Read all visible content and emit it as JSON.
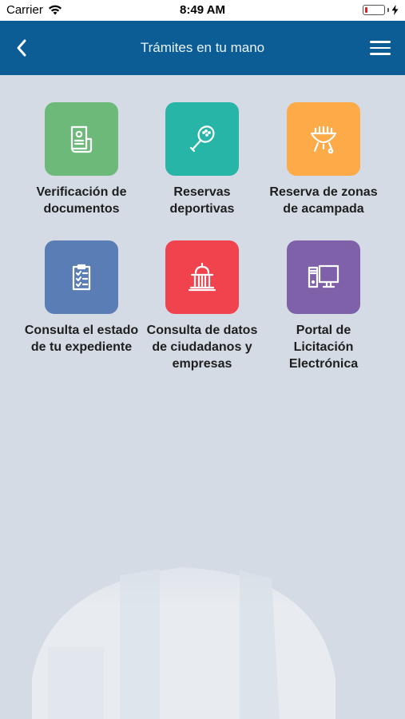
{
  "status_bar": {
    "carrier": "Carrier",
    "time": "8:49 AM",
    "battery_level": 0.15
  },
  "nav": {
    "title": "Trámites en tu mano",
    "back_icon": "chevron-left-icon",
    "menu_icon": "hamburger-menu-icon",
    "background_color": "#0c5d96"
  },
  "tiles": [
    {
      "label": "Verificación de documentos",
      "icon": "document-certificate-icon",
      "color": "#6db97a"
    },
    {
      "label": "Reservas deportivas",
      "icon": "paddle-racket-icon",
      "color": "#27b5a8"
    },
    {
      "label": "Reserva de zonas de acampada",
      "icon": "barbecue-grill-icon",
      "color": "#fdaa48"
    },
    {
      "label": "Consulta el estado de tu expediente",
      "icon": "clipboard-checklist-icon",
      "color": "#5a7db6"
    },
    {
      "label": "Consulta de datos de ciudadanos y empresas",
      "icon": "government-building-icon",
      "color": "#f0434e"
    },
    {
      "label": "Portal de Licitación Electrónica",
      "icon": "computer-monitor-icon",
      "color": "#7f61aa"
    }
  ]
}
